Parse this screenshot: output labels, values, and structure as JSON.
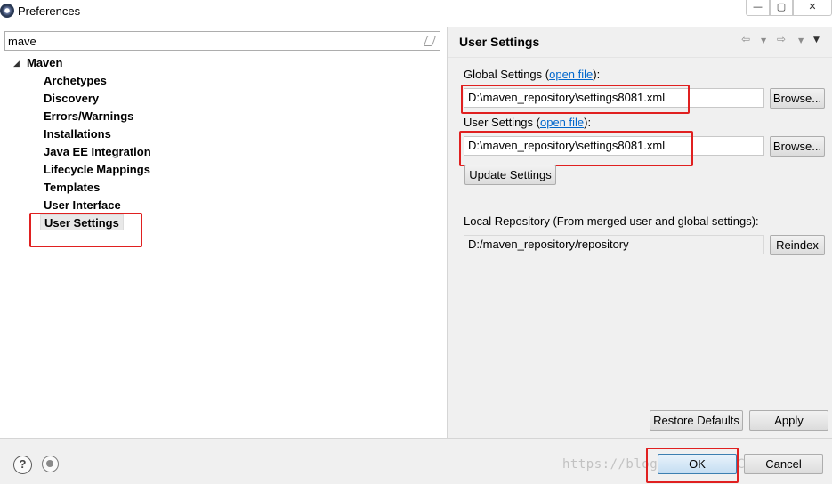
{
  "window": {
    "title": "Preferences",
    "minimize_glyph": "—",
    "maximize_glyph": "▢",
    "close_glyph": "✕"
  },
  "filter": {
    "value": "mave"
  },
  "tree": {
    "root": "Maven",
    "toggle_glyph": "◢",
    "children": [
      "Archetypes",
      "Discovery",
      "Errors/Warnings",
      "Installations",
      "Java EE Integration",
      "Lifecycle Mappings",
      "Templates",
      "User Interface",
      "User Settings"
    ],
    "selected": "User Settings"
  },
  "page": {
    "title": "User Settings",
    "nav": {
      "back_glyph": "⇦",
      "forward_glyph": "⇨",
      "menu_glyph": "▼"
    },
    "global_settings": {
      "label_prefix": "Global Settings (",
      "link": "open file",
      "label_suffix": "):",
      "value": "D:\\maven_repository\\settings8081.xml",
      "browse": "Browse..."
    },
    "user_settings": {
      "label_prefix": "User Settings (",
      "link": "open file",
      "label_suffix": "):",
      "value": "D:\\maven_repository\\settings8081.xml",
      "browse": "Browse..."
    },
    "update_settings": "Update Settings",
    "local_repository": {
      "label": "Local Repository (From merged user and global settings):",
      "value": "D:/maven_repository/repository",
      "reindex": "Reindex"
    },
    "restore_defaults": "Restore Defaults",
    "apply": "Apply"
  },
  "footer": {
    "help_glyph": "?",
    "watermark": "https://blog.csdn.net/CCKA",
    "ok": "OK",
    "cancel": "Cancel"
  },
  "colors": {
    "highlight_red": "#e02020",
    "link_blue": "#0066cc",
    "pane_bg": "#f0f0f0"
  }
}
